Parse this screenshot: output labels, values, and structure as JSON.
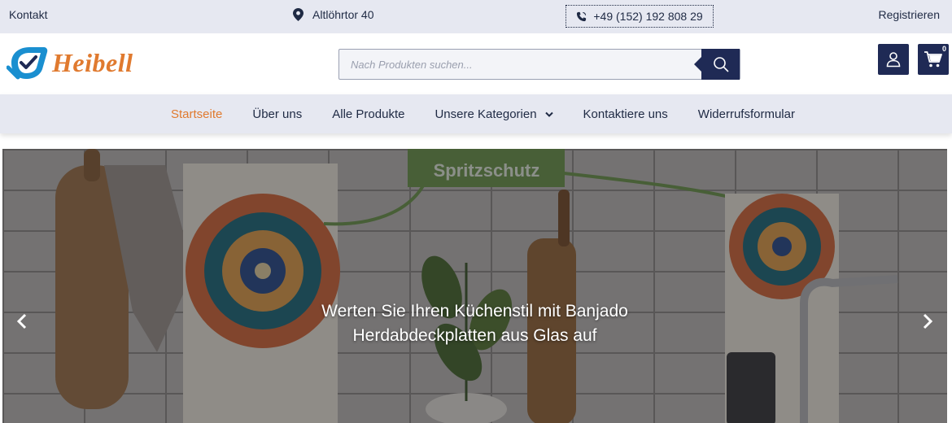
{
  "topbar": {
    "contact": "Kontakt",
    "address": "Altlöhrtor 40",
    "phone": "+49 (152) 192 808 29",
    "register": "Registrieren"
  },
  "header": {
    "logo_text": "Heibell",
    "search_placeholder": "Nach Produkten suchen...",
    "cart_count": "0"
  },
  "nav": {
    "items": [
      {
        "label": "Startseite",
        "active": true
      },
      {
        "label": "Über uns"
      },
      {
        "label": "Alle Produkte"
      },
      {
        "label": "Unsere Kategorien",
        "has_dropdown": true
      },
      {
        "label": "Kontaktiere uns"
      },
      {
        "label": "Widerrufsformular"
      }
    ]
  },
  "hero": {
    "badge": "Spritzschutz",
    "caption_line1": "Werten Sie Ihren Küchenstil mit Banjado",
    "caption_line2": "Herdabdeckplatten aus Glas auf"
  },
  "colors": {
    "brand_navy": "#1f2a55",
    "accent_orange": "#e07a2f",
    "bar_bg": "#e6e8f1"
  }
}
